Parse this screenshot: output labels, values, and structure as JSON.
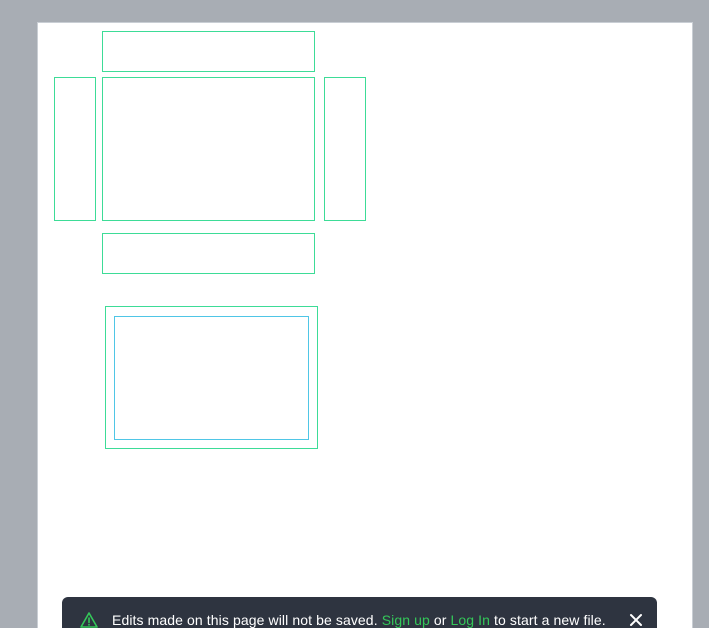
{
  "notice": {
    "message_before": "Edits made on this page will not be saved. ",
    "signup_link": "Sign up",
    "middle": " or ",
    "login_link": "Log In",
    "message_after": " to start a new file."
  },
  "colors": {
    "backdrop": "#a8adb4",
    "page": "#ffffff",
    "box_outline": "#3ddc97",
    "inner_outline": "#4fc6e6",
    "toast_background": "#2e3440",
    "link": "#34c759"
  },
  "icons": {
    "warning": "warning-triangle-icon",
    "close": "close-icon"
  }
}
